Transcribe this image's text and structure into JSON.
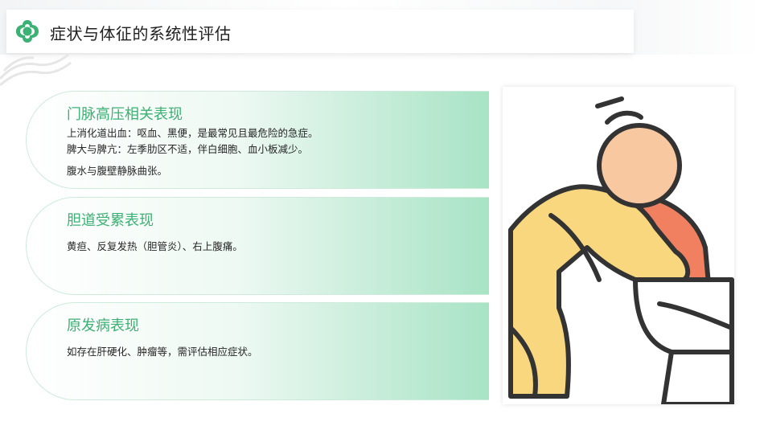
{
  "page": {
    "title": "症状与体征的系统性评估"
  },
  "colors": {
    "accent_green": "#3bb173",
    "card_gradient_end": "#a8e3c5"
  },
  "cards": [
    {
      "title": "门脉高压相关表现",
      "lines": [
        "上消化道出血：呕血、黑便，是最常见且最危险的急症。",
        "脾大与脾亢：左季肋区不适，伴白细胞、血小板减少。",
        "腹水与腹壁静脉曲张。"
      ]
    },
    {
      "title": "胆道受累表现",
      "lines": [
        "黄疸、反复发热（胆管炎）、右上腹痛。"
      ]
    },
    {
      "title": "原发病表现",
      "lines": [
        "如存在肝硬化、肿瘤等，需评估相应症状。"
      ]
    }
  ],
  "illustration": {
    "icon": "vomiting-person-icon"
  }
}
